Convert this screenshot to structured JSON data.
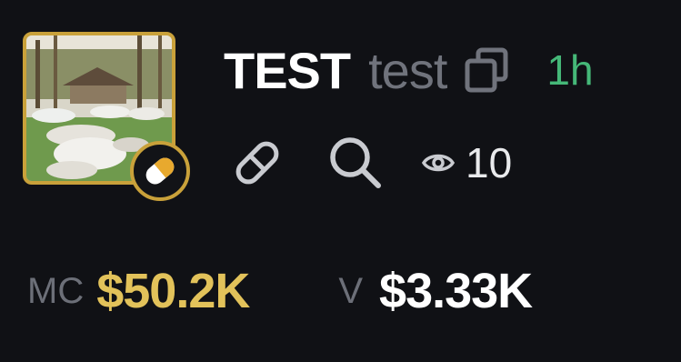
{
  "token": {
    "name": "TEST",
    "ticker": "test",
    "age": "1h",
    "image_icon": "token-image",
    "badge_icon": "pill-icon"
  },
  "actions": {
    "copy_icon": "copy-icon",
    "link_icon": "link-icon",
    "search_icon": "search-icon",
    "views_icon": "eye-icon",
    "views": "10"
  },
  "stats": {
    "mc_label": "MC",
    "mc_value": "$50.2K",
    "v_label": "V",
    "v_value": "$3.33K"
  },
  "colors": {
    "background": "#101115",
    "gold": "#c9a13a",
    "mc_value": "#e2c25a",
    "age": "#45b878",
    "muted": "#70737c"
  }
}
